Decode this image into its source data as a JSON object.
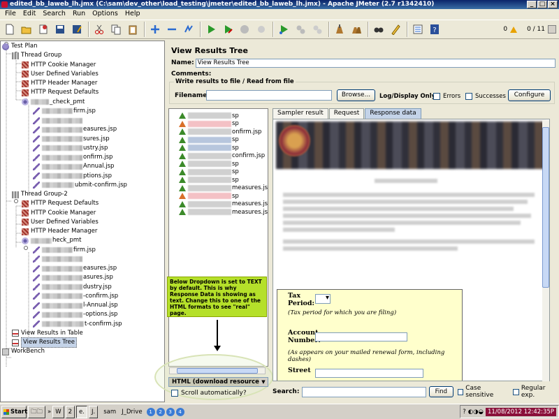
{
  "window": {
    "title": "edited_bb_laweb_lh.jmx (C:\\sam\\dev_other\\load_testing\\jmeter\\edited_bb_laweb_lh.jmx) - Apache JMeter (2.7 r1342410)",
    "min": "_",
    "max": "□",
    "close": "×"
  },
  "menu": [
    "File",
    "Edit",
    "Search",
    "Run",
    "Options",
    "Help"
  ],
  "toolbar": {
    "icons": [
      "new-icon",
      "open-icon",
      "open-templates-icon",
      "save-icon",
      "save-as-icon",
      "cut-icon",
      "copy-icon",
      "paste-icon",
      "expand-icon",
      "collapse-icon",
      "toggle-icon",
      "start-icon",
      "start-no-pauses-icon",
      "stop-icon",
      "shutdown-icon",
      "remote-start-icon",
      "remote-stop-icon",
      "remote-shutdown-icon",
      "clear-icon",
      "clear-all-icon",
      "search-icon",
      "reset-search-icon",
      "function-helper-icon",
      "help-icon"
    ],
    "warn_count": "0",
    "threads": "0 / 11"
  },
  "tree": {
    "items": [
      {
        "label": "Test Plan",
        "icon": "test-plan-icon"
      },
      {
        "label": "Thread Group",
        "icon": "thread-group-icon"
      },
      {
        "label": "HTTP Cookie Manager",
        "icon": "config-element-icon"
      },
      {
        "label": "User Defined Variables",
        "icon": "config-element-icon"
      },
      {
        "label": "HTTP Header Manager",
        "icon": "config-element-icon"
      },
      {
        "label": "HTTP Request Defaults",
        "icon": "config-element-icon"
      },
      {
        "label": "_check_pmt",
        "icon": "controller-icon"
      },
      {
        "label": "firm.jsp",
        "icon": "sampler-icon"
      },
      {
        "label": "",
        "icon": "sampler-icon"
      },
      {
        "label": "easures.jsp",
        "icon": "sampler-icon"
      },
      {
        "label": "sures.jsp",
        "icon": "sampler-icon"
      },
      {
        "label": "ustry.jsp",
        "icon": "sampler-icon"
      },
      {
        "label": "onfirm.jsp",
        "icon": "sampler-icon"
      },
      {
        "label": "Annual.jsp",
        "icon": "sampler-icon"
      },
      {
        "label": "ptions.jsp",
        "icon": "sampler-icon"
      },
      {
        "label": "ubmit-confirm.jsp",
        "icon": "sampler-icon"
      },
      {
        "label": "Thread Group-2",
        "icon": "thread-group-icon"
      },
      {
        "label": "HTTP Request Defaults",
        "icon": "config-element-icon"
      },
      {
        "label": "HTTP Cookie Manager",
        "icon": "config-element-icon"
      },
      {
        "label": "User Defined Variables",
        "icon": "config-element-icon"
      },
      {
        "label": "HTTP Header Manager",
        "icon": "config-element-icon"
      },
      {
        "label": "heck_pmt",
        "icon": "controller-icon"
      },
      {
        "label": "firm.jsp",
        "icon": "sampler-icon"
      },
      {
        "label": "",
        "icon": "sampler-icon"
      },
      {
        "label": "easures.jsp",
        "icon": "sampler-icon"
      },
      {
        "label": "asures.jsp",
        "icon": "sampler-icon"
      },
      {
        "label": "dustry.jsp",
        "icon": "sampler-icon"
      },
      {
        "label": "-confirm.jsp",
        "icon": "sampler-icon"
      },
      {
        "label": "l-Annual.jsp",
        "icon": "sampler-icon"
      },
      {
        "label": "-options.jsp",
        "icon": "sampler-icon"
      },
      {
        "label": "t-confirm.jsp",
        "icon": "sampler-icon"
      },
      {
        "label": "View Results in Table",
        "icon": "listener-icon"
      },
      {
        "label": "View Results Tree",
        "icon": "listener-icon"
      },
      {
        "label": "WorkBench",
        "icon": "workbench-icon"
      }
    ]
  },
  "panel": {
    "title": "View Results Tree",
    "name_label": "Name:",
    "name_value": "View Results Tree",
    "comments_label": "Comments:",
    "write_title": "Write results to file / Read from file",
    "filename_label": "Filename",
    "browse": "Browse...",
    "log_display": "Log/Display Only:",
    "errors": "Errors",
    "successes": "Successes",
    "configure": "Configure"
  },
  "results": [
    {
      "status": "ok",
      "text": "sp"
    },
    {
      "status": "error",
      "text": "sp"
    },
    {
      "status": "ok",
      "text": "onfirm.jsp"
    },
    {
      "status": "ok",
      "text": "sp"
    },
    {
      "status": "ok",
      "text": "sp"
    },
    {
      "status": "ok",
      "text": "confirm.jsp"
    },
    {
      "status": "ok",
      "text": "sp"
    },
    {
      "status": "ok",
      "text": "sp"
    },
    {
      "status": "ok",
      "text": "sp"
    },
    {
      "status": "ok",
      "text": "measures.jsp"
    },
    {
      "status": "error",
      "text": "sp"
    },
    {
      "status": "ok",
      "text": "measures.jsp"
    },
    {
      "status": "ok",
      "text": "measures.jsp"
    }
  ],
  "annotation": "Below Dropdown is set to TEXT by default. This is why Response Data is showing as text. Change this to one of the HTML formats to see \"real\" page.",
  "renderer": "HTML (download resources)",
  "scroll_auto": "Scroll automatically?",
  "tabs": [
    "Sampler result",
    "Request",
    "Response data"
  ],
  "form": {
    "tax_period": "Tax Period:",
    "tax_hint": "(Tax period for which you are filing)",
    "account": "Account Number:",
    "account_hint": "(As appears on your mailed renewal form, including dashes)",
    "street": "Street"
  },
  "search": {
    "label": "Search:",
    "find": "Find",
    "case": "Case sensitive",
    "regex": "Regular exp."
  },
  "taskbar": {
    "start": "Start",
    "items": [
      "W",
      "2",
      "e.",
      "J.",
      "sam",
      "J_Drive"
    ],
    "date": "11/08/2012",
    "time": "12:42:35P",
    "task_numbers": [
      "1",
      "2",
      "3",
      "4"
    ]
  },
  "colors": {
    "annotation_bg": "#b5e02a",
    "title_bar": "#0a246a",
    "tab_active": "#c4d3e8"
  }
}
